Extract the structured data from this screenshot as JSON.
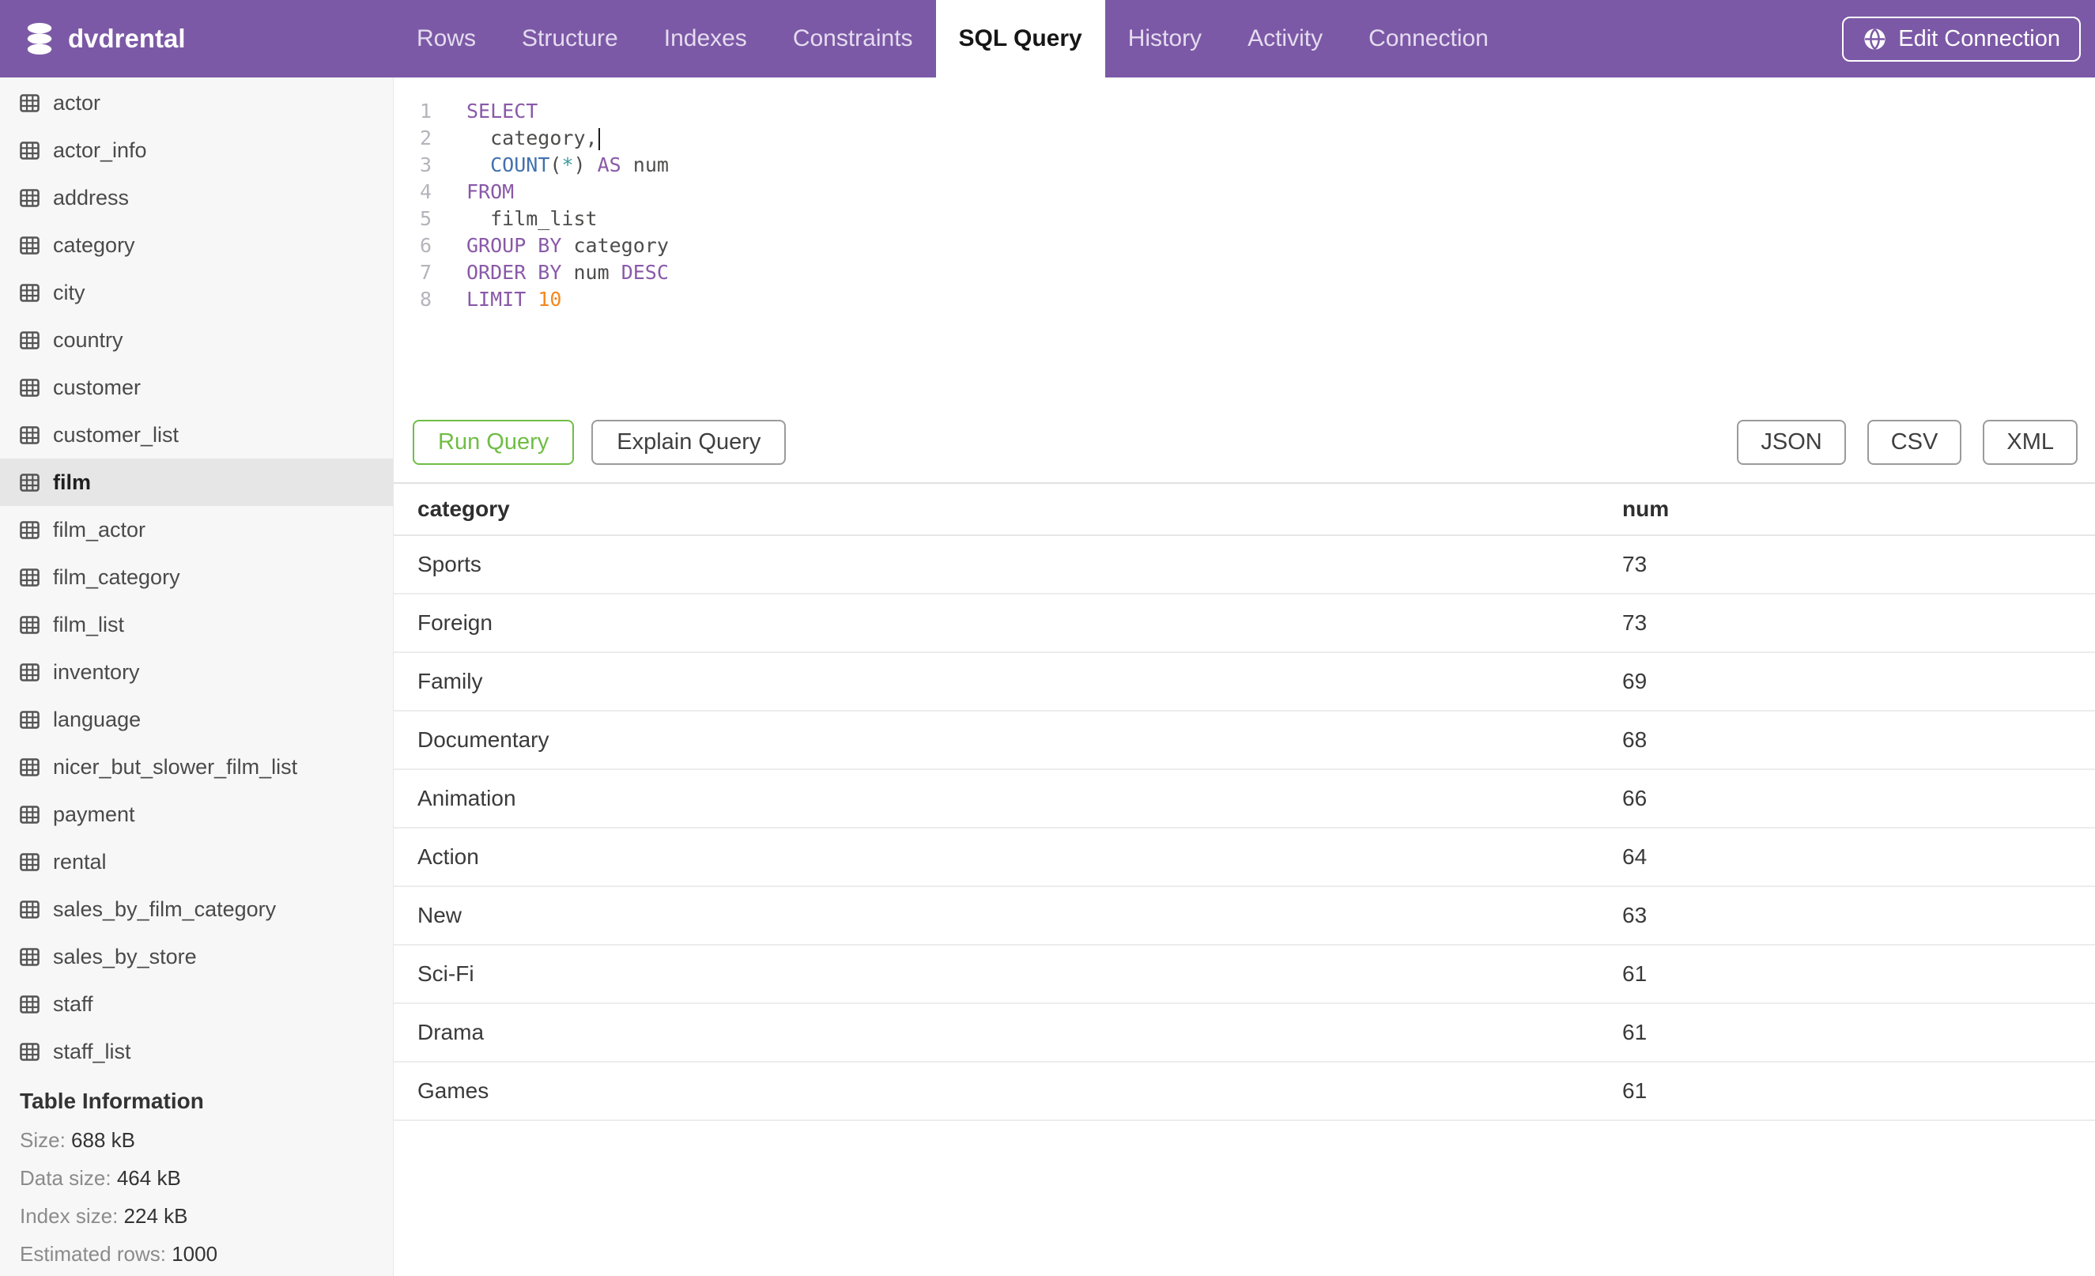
{
  "header": {
    "brand": "dvdrental",
    "tabs": [
      {
        "label": "Rows",
        "active": false
      },
      {
        "label": "Structure",
        "active": false
      },
      {
        "label": "Indexes",
        "active": false
      },
      {
        "label": "Constraints",
        "active": false
      },
      {
        "label": "SQL Query",
        "active": true
      },
      {
        "label": "History",
        "active": false
      },
      {
        "label": "Activity",
        "active": false
      },
      {
        "label": "Connection",
        "active": false
      }
    ],
    "edit_connection_label": "Edit Connection"
  },
  "sidebar": {
    "tables": [
      "actor",
      "actor_info",
      "address",
      "category",
      "city",
      "country",
      "customer",
      "customer_list",
      "film",
      "film_actor",
      "film_category",
      "film_list",
      "inventory",
      "language",
      "nicer_but_slower_film_list",
      "payment",
      "rental",
      "sales_by_film_category",
      "sales_by_store",
      "staff",
      "staff_list"
    ],
    "selected_table": "film",
    "table_information": {
      "heading": "Table Information",
      "rows": [
        {
          "label": "Size:",
          "value": "688 kB"
        },
        {
          "label": "Data size:",
          "value": "464 kB"
        },
        {
          "label": "Index size:",
          "value": "224 kB"
        },
        {
          "label": "Estimated rows:",
          "value": "1000"
        }
      ]
    }
  },
  "editor": {
    "lines": [
      {
        "n": "1",
        "tokens": [
          {
            "text": "SELECT",
            "type": "kw"
          }
        ]
      },
      {
        "n": "2",
        "tokens": [
          {
            "text": "  category,",
            "type": "plain"
          }
        ],
        "cursor": true
      },
      {
        "n": "3",
        "tokens": [
          {
            "text": "  ",
            "type": "plain"
          },
          {
            "text": "COUNT",
            "type": "fn"
          },
          {
            "text": "(",
            "type": "plain"
          },
          {
            "text": "*",
            "type": "star"
          },
          {
            "text": ") ",
            "type": "plain"
          },
          {
            "text": "AS",
            "type": "kw"
          },
          {
            "text": " num",
            "type": "plain"
          }
        ]
      },
      {
        "n": "4",
        "tokens": [
          {
            "text": "FROM",
            "type": "kw"
          }
        ]
      },
      {
        "n": "5",
        "tokens": [
          {
            "text": "  film_list",
            "type": "plain"
          }
        ]
      },
      {
        "n": "6",
        "tokens": [
          {
            "text": "GROUP BY",
            "type": "kw"
          },
          {
            "text": " category",
            "type": "plain"
          }
        ]
      },
      {
        "n": "7",
        "tokens": [
          {
            "text": "ORDER BY",
            "type": "kw"
          },
          {
            "text": " num ",
            "type": "plain"
          },
          {
            "text": "DESC",
            "type": "kw"
          }
        ]
      },
      {
        "n": "8",
        "tokens": [
          {
            "text": "LIMIT",
            "type": "kw"
          },
          {
            "text": " ",
            "type": "plain"
          },
          {
            "text": "10",
            "type": "num"
          }
        ]
      }
    ]
  },
  "toolbar": {
    "run": "Run Query",
    "explain": "Explain Query",
    "export": [
      "JSON",
      "CSV",
      "XML"
    ]
  },
  "results": {
    "columns": [
      "category",
      "num"
    ],
    "rows": [
      [
        "Sports",
        73
      ],
      [
        "Foreign",
        73
      ],
      [
        "Family",
        69
      ],
      [
        "Documentary",
        68
      ],
      [
        "Animation",
        66
      ],
      [
        "Action",
        64
      ],
      [
        "New",
        63
      ],
      [
        "Sci-Fi",
        61
      ],
      [
        "Drama",
        61
      ],
      [
        "Games",
        61
      ]
    ]
  },
  "icons": {
    "brand": "database-icon",
    "edit_connection": "globe-icon",
    "sidebar_table": "table-icon"
  },
  "colors": {
    "header_purple": "#7c59a6",
    "run_green": "#70bd45",
    "sql_keyword": "#8959a8",
    "sql_function": "#4271ae",
    "sql_star": "#3e999f",
    "sql_number": "#f5871f",
    "sidebar_bg": "#f7f7f7",
    "selected_row_bg": "#e6e6e6"
  }
}
